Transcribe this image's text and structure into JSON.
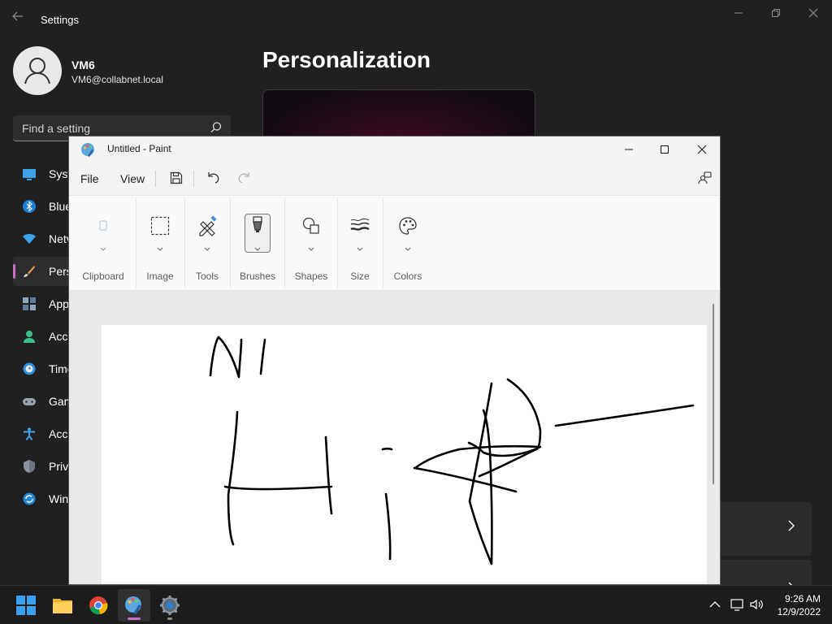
{
  "settings": {
    "title": "Settings",
    "user": {
      "name": "VM6",
      "email": "VM6@collabnet.local"
    },
    "search_placeholder": "Find a setting",
    "page_title": "Personalization",
    "nav": [
      {
        "label": "Syst",
        "icon": "system-icon"
      },
      {
        "label": "Blue",
        "icon": "bluetooth-icon"
      },
      {
        "label": "Netv",
        "icon": "network-icon"
      },
      {
        "label": "Pers",
        "icon": "personalization-brush-icon",
        "selected": true
      },
      {
        "label": "App",
        "icon": "apps-icon"
      },
      {
        "label": "Acco",
        "icon": "accounts-icon"
      },
      {
        "label": "Time",
        "icon": "time-language-icon"
      },
      {
        "label": "Gam",
        "icon": "gaming-icon"
      },
      {
        "label": "Acce",
        "icon": "accessibility-icon"
      },
      {
        "label": "Priv",
        "icon": "privacy-shield-icon"
      },
      {
        "label": "Win",
        "icon": "windows-update-icon"
      }
    ]
  },
  "paint": {
    "title": "Untitled - Paint",
    "menu": {
      "file": "File",
      "view": "View"
    },
    "ribbon": {
      "clipboard": "Clipboard",
      "image": "Image",
      "tools": "Tools",
      "brushes": "Brushes",
      "shapes": "Shapes",
      "size": "Size",
      "colors": "Colors"
    }
  },
  "taskbar": {
    "apps": [
      "start-icon",
      "file-explorer-icon",
      "chrome-icon",
      "paint-icon",
      "settings-gear-icon"
    ],
    "time": "9:26 AM",
    "date": "12/9/2022"
  },
  "colors": {
    "accent": "#c670c7",
    "settings_bg": "#202020",
    "paint_bg": "#f3f3f3"
  }
}
